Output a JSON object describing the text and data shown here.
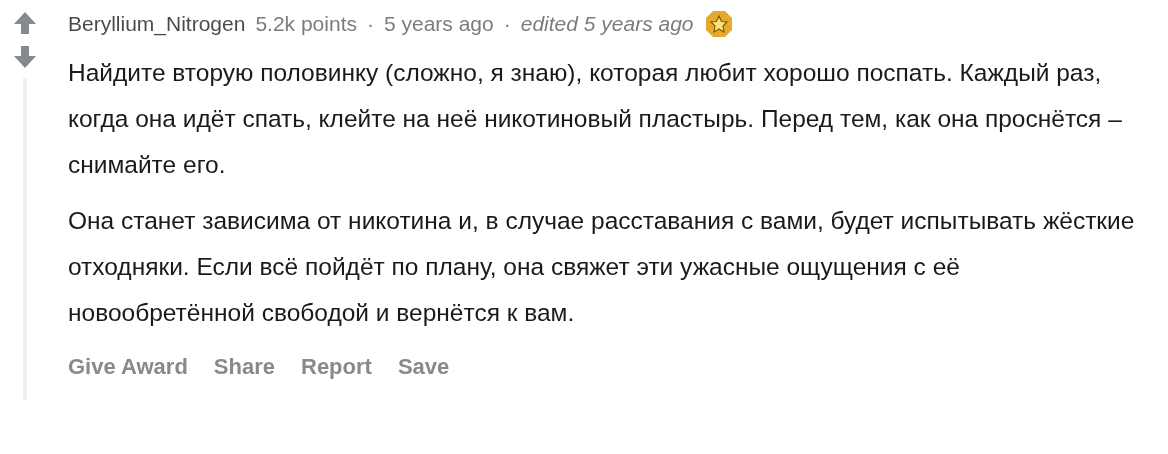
{
  "comment": {
    "author": "Beryllium_Nitrogen",
    "points": "5.2k points",
    "separator_1": "·",
    "time": "5 years ago",
    "separator_2": "·",
    "edited": "edited 5 years ago",
    "paragraphs": [
      "Найдите вторую половинку (сложно, я знаю), которая любит хорошо поспать. Каждый раз, когда она идёт спать, клейте на неё никотиновый пластырь. Перед тем, как она проснётся – снимайте его.",
      "Она станет зависима от никотина и, в случае расставания с вами, будет испытывать жёсткие отходняки. Если всё пойдёт по плану, она свяжет эти ужасные ощущения с её новообретённой свободой и вернётся к вам."
    ],
    "actions": [
      "Give Award",
      "Share",
      "Report",
      "Save"
    ]
  }
}
